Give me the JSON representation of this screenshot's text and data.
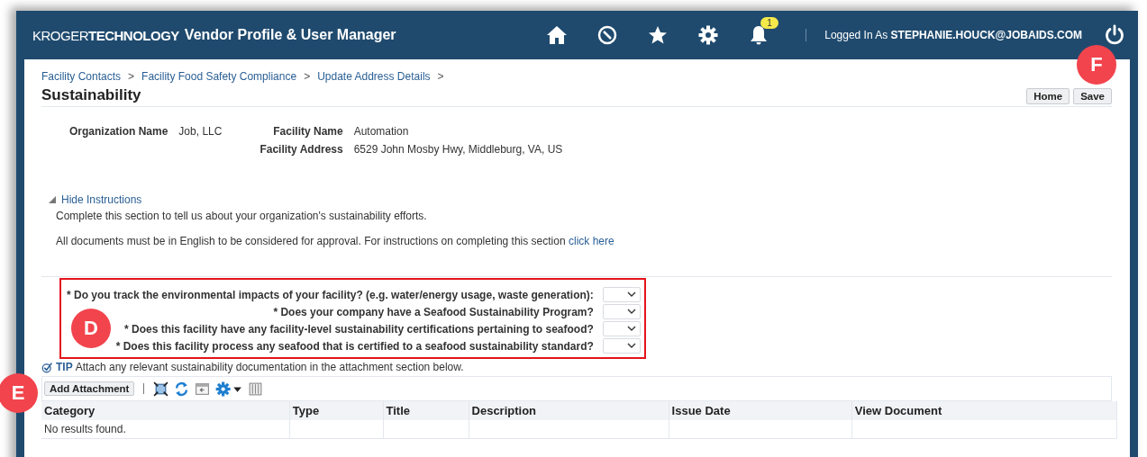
{
  "header": {
    "brand_light": "KROGER",
    "brand_bold": "TECHNOLOGY",
    "title": "Vendor Profile & User Manager",
    "notification_count": "1",
    "logged_in_label": "Logged In As",
    "user": "STEPHANIE.HOUCK@JOBAIDS.COM"
  },
  "breadcrumbs": [
    "Facility Contacts",
    "Facility Food Safety Compliance",
    "Update Address Details"
  ],
  "breadcrumb_separator": ">",
  "page_title": "Sustainability",
  "buttons": [
    "Home",
    "Save"
  ],
  "details": [
    {
      "label": "Organization Name",
      "value": "Job, LLC"
    },
    {
      "label": "Facility Name",
      "value": "Automation"
    },
    {
      "label": "Facility Address",
      "value": "6529 John Mosby Hwy, Middleburg, VA, US"
    }
  ],
  "instructions": {
    "toggle": "Hide Instructions",
    "expanded": true,
    "line1": "Complete this section to tell us about your organization's sustainability efforts.",
    "line2": "All documents must be in English to be considered for approval. For instructions on completing this section",
    "link": "click here"
  },
  "questions": [
    {
      "label": "* Do you track the environmental impacts of your facility? (e.g. water/energy usage, waste generation):"
    },
    {
      "label": "* Does your company have a Seafood Sustainability Program?"
    },
    {
      "label": "* Does this facility have any facility-level sustainability certifications pertaining to seafood?"
    },
    {
      "label": "* Does this facility process any seafood that is certified to a seafood sustainability standard?"
    }
  ],
  "tip": {
    "label": "TIP",
    "text": "Attach any relevant sustainability documentation in the attachment section below."
  },
  "toolbar": {
    "add_button": "Add Attachment"
  },
  "table": {
    "columns": [
      "Category",
      "Type",
      "Title",
      "Description",
      "Issue Date",
      "View Document"
    ],
    "empty_text": "No results found."
  },
  "callouts": [
    {
      "label": "F"
    },
    {
      "label": "D"
    },
    {
      "label": "E"
    }
  ]
}
